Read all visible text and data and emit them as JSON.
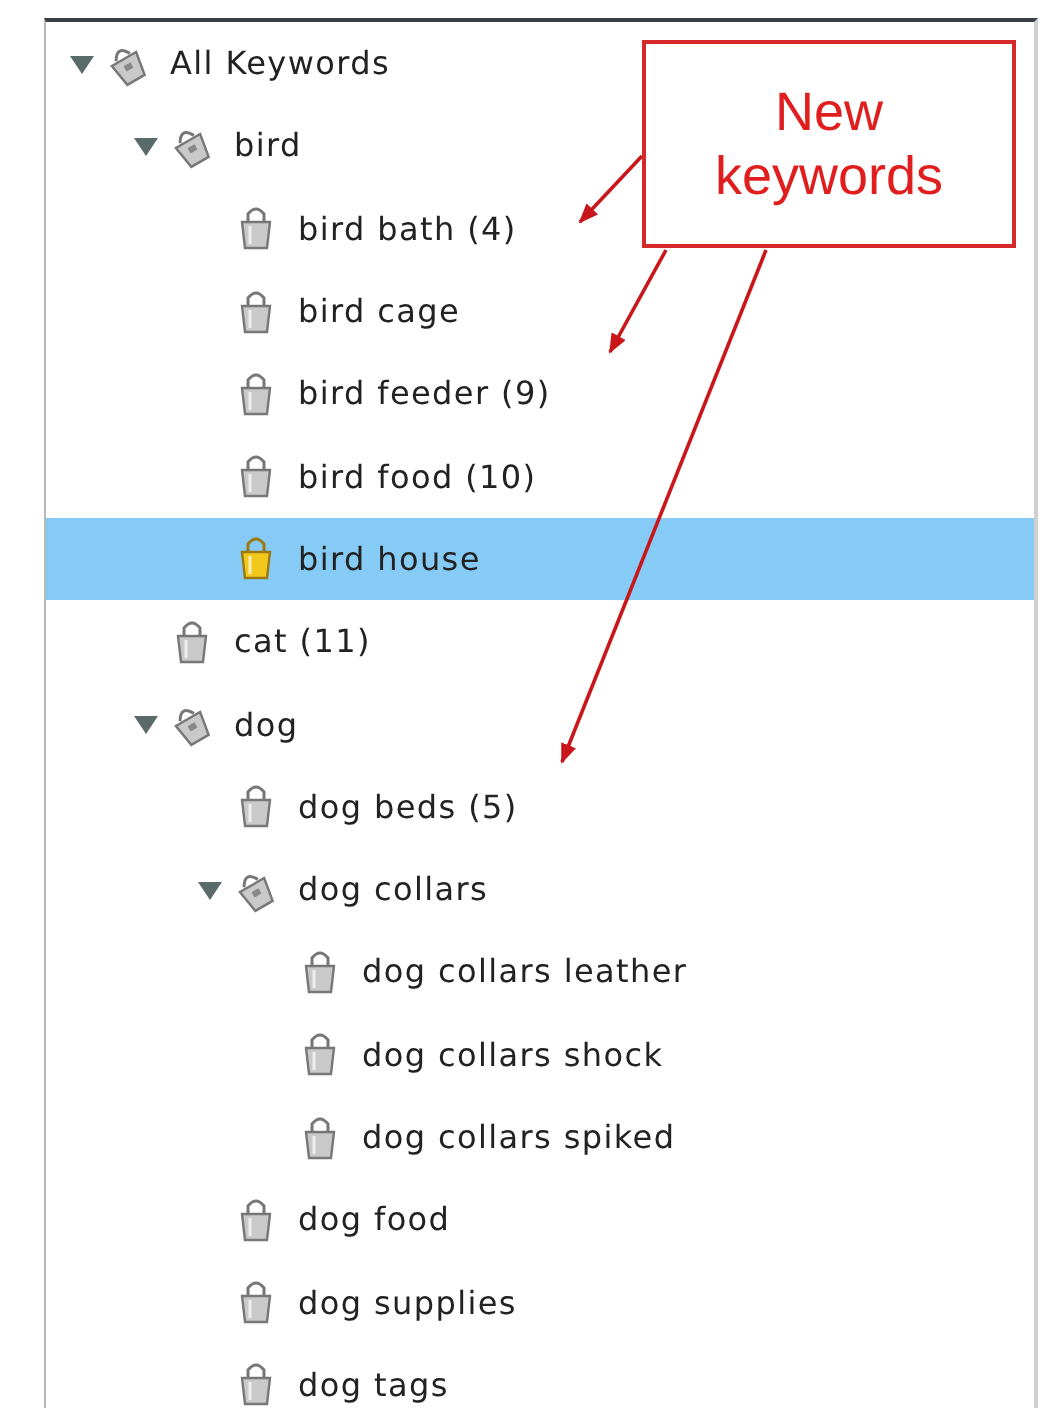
{
  "tree": [
    {
      "label": "All Keywords",
      "kind": "folder",
      "expanded": true,
      "selected": false,
      "children": [
        {
          "label": "bird",
          "kind": "folder",
          "expanded": true,
          "selected": false,
          "children": [
            {
              "label": "bird bath (4)",
              "kind": "keyword",
              "selected": false
            },
            {
              "label": "bird cage",
              "kind": "keyword",
              "selected": false
            },
            {
              "label": "bird feeder (9)",
              "kind": "keyword",
              "selected": false
            },
            {
              "label": "bird food (10)",
              "kind": "keyword",
              "selected": false
            },
            {
              "label": "bird house",
              "kind": "keyword",
              "selected": true
            }
          ]
        },
        {
          "label": "cat (11)",
          "kind": "keyword",
          "selected": false
        },
        {
          "label": "dog",
          "kind": "folder",
          "expanded": true,
          "selected": false,
          "children": [
            {
              "label": "dog beds (5)",
              "kind": "keyword",
              "selected": false
            },
            {
              "label": "dog collars",
              "kind": "folder",
              "expanded": true,
              "selected": false,
              "children": [
                {
                  "label": "dog collars leather",
                  "kind": "keyword",
                  "selected": false
                },
                {
                  "label": "dog collars shock",
                  "kind": "keyword",
                  "selected": false
                },
                {
                  "label": "dog collars spiked",
                  "kind": "keyword",
                  "selected": false
                }
              ]
            },
            {
              "label": "dog food",
              "kind": "keyword",
              "selected": false
            },
            {
              "label": "dog supplies",
              "kind": "keyword",
              "selected": false
            },
            {
              "label": "dog tags",
              "kind": "keyword",
              "selected": false
            }
          ]
        }
      ]
    }
  ],
  "callout": {
    "text": "New keywords"
  }
}
